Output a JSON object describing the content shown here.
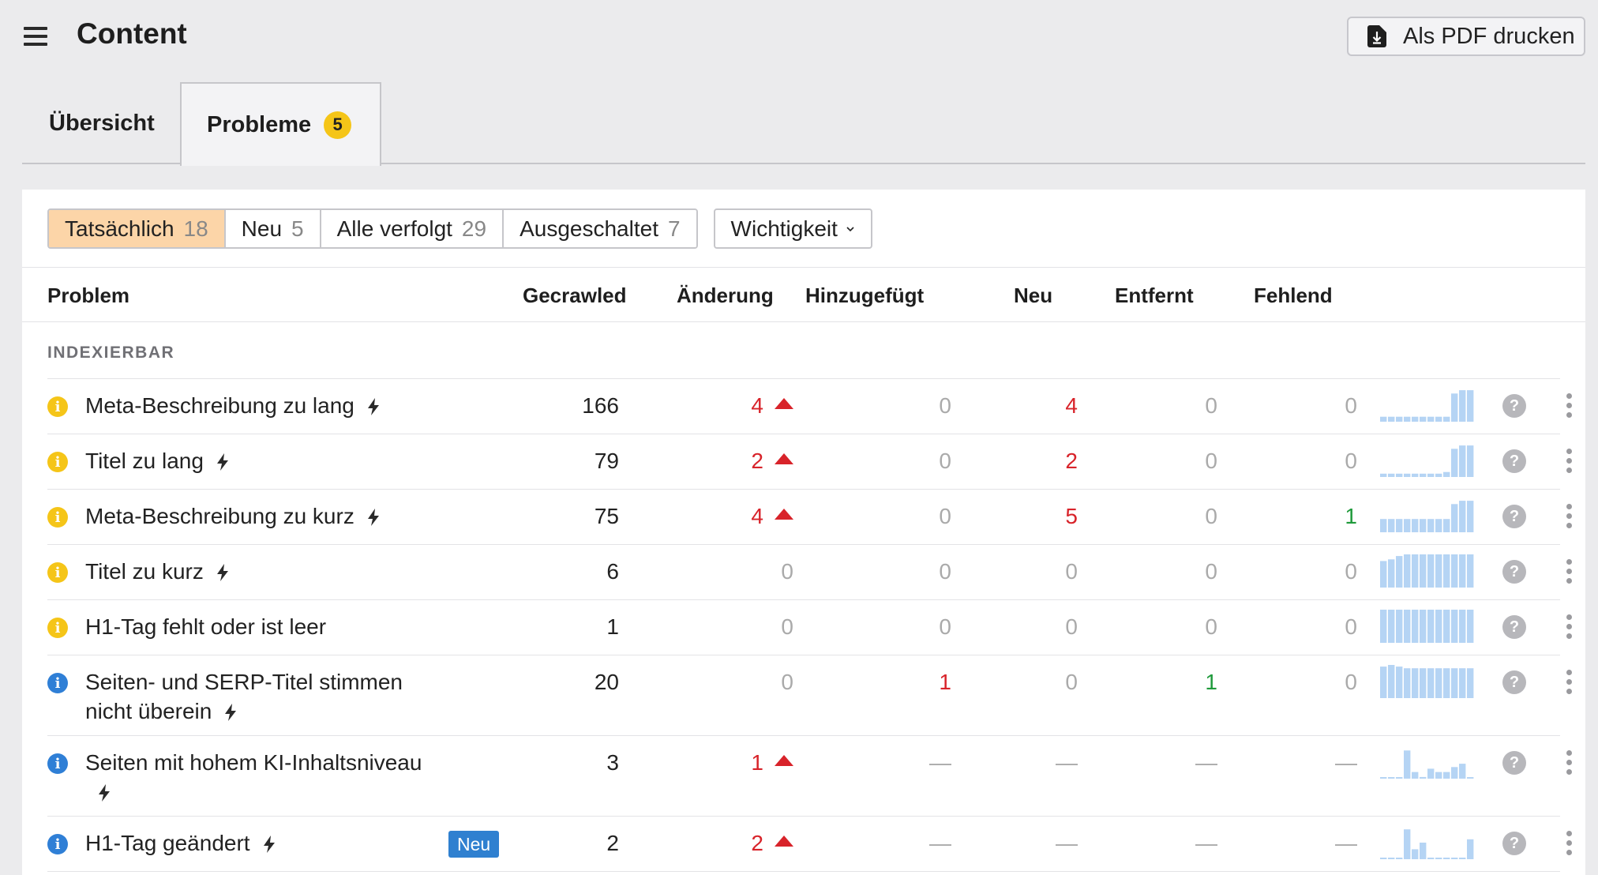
{
  "header": {
    "title": "Content",
    "pdf_button": "Als PDF drucken"
  },
  "tabs": [
    {
      "label": "Übersicht"
    },
    {
      "label": "Probleme",
      "count": "5"
    }
  ],
  "filters": [
    {
      "label": "Tatsächlich",
      "count": "18",
      "active": true
    },
    {
      "label": "Neu",
      "count": "5"
    },
    {
      "label": "Alle verfolgt",
      "count": "29"
    },
    {
      "label": "Ausgeschaltet",
      "count": "7"
    }
  ],
  "sort_dropdown": "Wichtigkeit",
  "columns": {
    "problem": "Problem",
    "crawled": "Gecrawled",
    "change": "Änderung",
    "added": "Hinzugefügt",
    "new": "Neu",
    "removed": "Entfernt",
    "missing": "Fehlend"
  },
  "group_label": "INDEXIERBAR",
  "colors": {
    "warn": "#f5c518",
    "info": "#2f7fd6",
    "negative": "#d8232a",
    "positive": "#1f9a3b",
    "spark": "#b5d4f4",
    "active_filter": "#fcd5a8"
  },
  "rows": [
    {
      "severity": "warn",
      "name": "Meta-Beschreibung zu lang",
      "bolt": true,
      "crawled": "166",
      "change": "4",
      "change_up": true,
      "added": "0",
      "new": "4",
      "removed": "0",
      "missing": "0",
      "spark": [
        0.15,
        0.15,
        0.15,
        0.15,
        0.15,
        0.15,
        0.15,
        0.15,
        0.15,
        0.85,
        0.95,
        0.95
      ]
    },
    {
      "severity": "warn",
      "name": "Titel zu lang",
      "bolt": true,
      "crawled": "79",
      "change": "2",
      "change_up": true,
      "added": "0",
      "new": "2",
      "removed": "0",
      "missing": "0",
      "spark": [
        0.1,
        0.1,
        0.1,
        0.1,
        0.1,
        0.1,
        0.1,
        0.1,
        0.15,
        0.85,
        0.95,
        0.95
      ]
    },
    {
      "severity": "warn",
      "name": "Meta-Beschreibung zu kurz",
      "bolt": true,
      "crawled": "75",
      "change": "4",
      "change_up": true,
      "added": "0",
      "new": "5",
      "removed": "0",
      "missing": "1",
      "spark": [
        0.4,
        0.4,
        0.4,
        0.4,
        0.4,
        0.4,
        0.4,
        0.4,
        0.4,
        0.85,
        0.95,
        0.95
      ]
    },
    {
      "severity": "warn",
      "name": "Titel zu kurz",
      "bolt": true,
      "crawled": "6",
      "change": "0",
      "change_up": false,
      "added": "0",
      "new": "0",
      "removed": "0",
      "missing": "0",
      "spark": [
        0.8,
        0.85,
        0.95,
        1,
        1,
        1,
        1,
        1,
        1,
        1,
        1,
        1
      ]
    },
    {
      "severity": "warn",
      "name": "H1-Tag fehlt oder ist leer",
      "bolt": false,
      "crawled": "1",
      "change": "0",
      "change_up": false,
      "added": "0",
      "new": "0",
      "removed": "0",
      "missing": "0",
      "spark": [
        1,
        1,
        1,
        1,
        1,
        1,
        1,
        1,
        1,
        1,
        1,
        1
      ]
    },
    {
      "severity": "info",
      "name": "Seiten- und SERP-Titel stimmen nicht überein",
      "bolt": true,
      "crawled": "20",
      "change": "0",
      "change_up": false,
      "added": "1",
      "new": "0",
      "removed": "1",
      "missing": "0",
      "spark": [
        0.95,
        1,
        0.95,
        0.9,
        0.9,
        0.9,
        0.9,
        0.9,
        0.9,
        0.9,
        0.9,
        0.9
      ]
    },
    {
      "severity": "info",
      "name": "Seiten mit hohem KI-Inhaltsniveau",
      "bolt": true,
      "crawled": "3",
      "change": "1",
      "change_up": true,
      "added": "—",
      "new": "—",
      "removed": "—",
      "missing": "—",
      "spark": [
        0.02,
        0.02,
        0.02,
        0.85,
        0.2,
        0.05,
        0.3,
        0.2,
        0.2,
        0.35,
        0.45,
        0.02
      ]
    },
    {
      "severity": "info",
      "name": "H1-Tag geändert",
      "bolt": true,
      "tag": "Neu",
      "crawled": "2",
      "change": "2",
      "change_up": true,
      "added": "—",
      "new": "—",
      "removed": "—",
      "missing": "—",
      "spark": [
        0.02,
        0.02,
        0.02,
        0.9,
        0.3,
        0.5,
        0.02,
        0.02,
        0.02,
        0.02,
        0.02,
        0.6
      ]
    }
  ]
}
